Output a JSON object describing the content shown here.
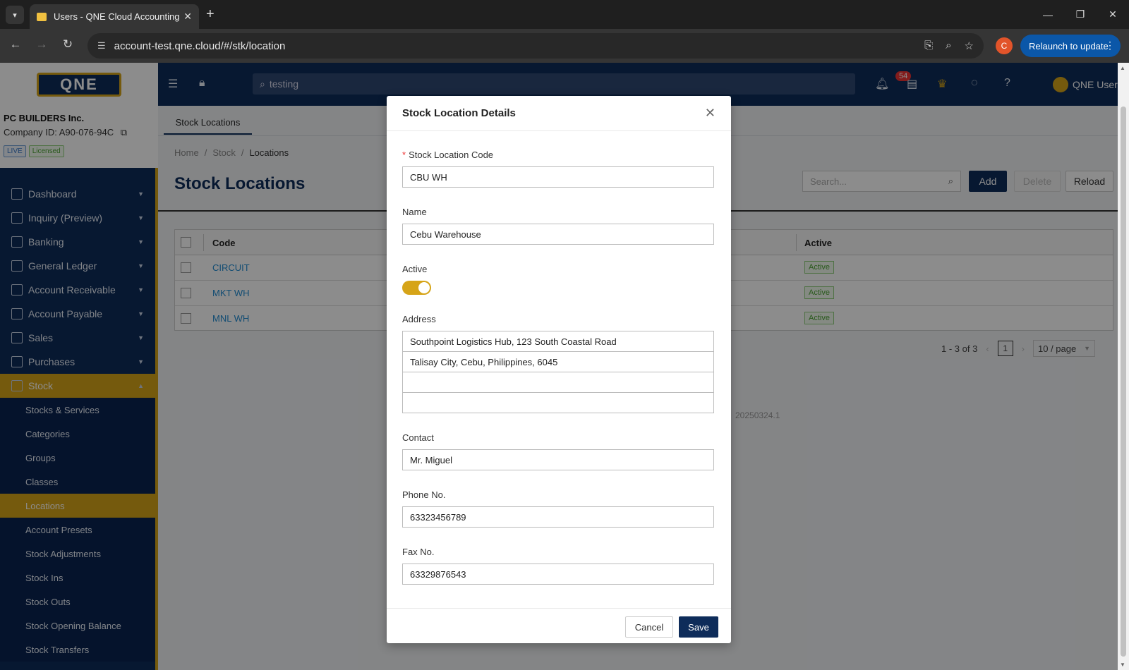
{
  "browser": {
    "tab_title": "Users - QNE Cloud Accounting",
    "url": "account-test.qne.cloud/#/stk/location",
    "profile_initial": "C",
    "relaunch_label": "Relaunch to update"
  },
  "app": {
    "logo_text": "QNE",
    "search_value": "testing",
    "notification_count": "54",
    "user_name": "QNE User"
  },
  "company": {
    "name": "PC BUILDERS Inc.",
    "id_label": "Company ID: A90-076-94C",
    "tag_live": "LIVE",
    "tag_licensed": "Licensed"
  },
  "sidebar": {
    "items": [
      {
        "label": "Dashboard"
      },
      {
        "label": "Inquiry (Preview)"
      },
      {
        "label": "Banking"
      },
      {
        "label": "General Ledger"
      },
      {
        "label": "Account Receivable"
      },
      {
        "label": "Account Payable"
      },
      {
        "label": "Sales"
      },
      {
        "label": "Purchases"
      },
      {
        "label": "Stock"
      }
    ],
    "sub_items": [
      {
        "label": "Stocks & Services"
      },
      {
        "label": "Categories"
      },
      {
        "label": "Groups"
      },
      {
        "label": "Classes"
      },
      {
        "label": "Locations"
      },
      {
        "label": "Account Presets"
      },
      {
        "label": "Stock Adjustments"
      },
      {
        "label": "Stock Ins"
      },
      {
        "label": "Stock Outs"
      },
      {
        "label": "Stock Opening Balance"
      },
      {
        "label": "Stock Transfers"
      }
    ]
  },
  "page": {
    "tab_label": "Stock Locations",
    "breadcrumb": [
      "Home",
      "Stock",
      "Locations"
    ],
    "title": "Stock Locations",
    "search_placeholder": "Search...",
    "add_label": "Add",
    "delete_label": "Delete",
    "reload_label": "Reload",
    "columns": {
      "code": "Code",
      "active": "Active"
    },
    "rows": [
      {
        "code": "CIRCUIT",
        "status": "Active"
      },
      {
        "code": "MKT WH",
        "status": "Active"
      },
      {
        "code": "MNL WH",
        "status": "Active"
      }
    ],
    "pager_range": "1 - 3 of 3",
    "pager_page": "1",
    "pager_size": "10 / page",
    "version": "20250324.1"
  },
  "modal": {
    "title": "Stock Location Details",
    "code_label": "Stock Location Code",
    "code_value": "CBU WH",
    "name_label": "Name",
    "name_value": "Cebu Warehouse",
    "active_label": "Active",
    "active_on": true,
    "address_label": "Address",
    "address_lines": [
      "Southpoint Logistics Hub, 123 South Coastal Road",
      "Talisay City, Cebu, Philippines, 6045",
      "",
      ""
    ],
    "contact_label": "Contact",
    "contact_value": "Mr. Miguel",
    "phone_label": "Phone No.",
    "phone_value": "63323456789",
    "fax_label": "Fax No.",
    "fax_value": "63329876543",
    "cancel_label": "Cancel",
    "save_label": "Save"
  },
  "colors": {
    "navy": "#0e2c5a",
    "gold": "#d6a418",
    "link": "#1f8ad1"
  }
}
